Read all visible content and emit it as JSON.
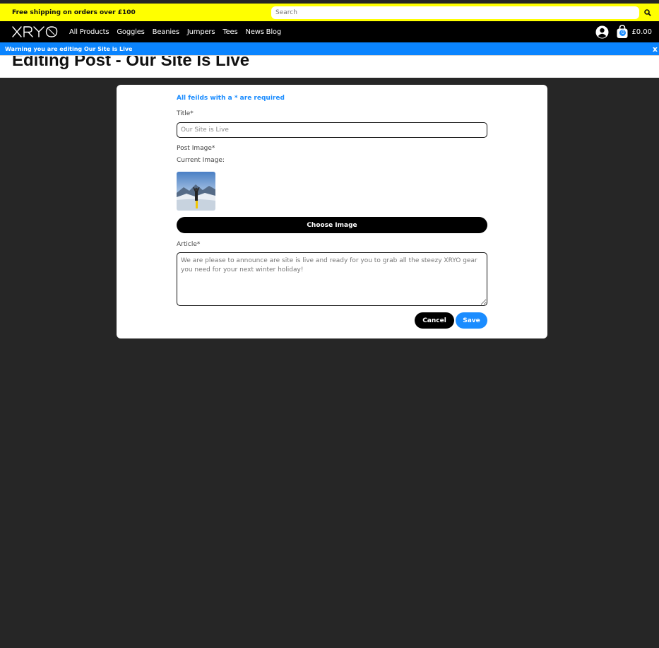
{
  "promo": {
    "text": "Free shipping on orders over £100"
  },
  "search": {
    "placeholder": "Search"
  },
  "nav": {
    "logo": "XRYO",
    "links": [
      "All Products",
      "Goggles",
      "Beanies",
      "Jumpers",
      "Tees",
      "News Blog"
    ],
    "cart_count": "0",
    "cart_total": "£0.00"
  },
  "warning": {
    "text": "Warning you are editing Our Site is Live",
    "close": "x"
  },
  "page": {
    "title": "Editing Post - Our Site Is Live"
  },
  "form": {
    "required_note": "All feilds with a * are required",
    "title_label": "Title*",
    "title_value": "Our Site is Live",
    "image_label": "Post Image*",
    "current_image_label": "Current Image:",
    "choose_image_label": "Choose Image",
    "article_label": "Article*",
    "article_value": "We are please to announce are site is live and ready for you to grab all the steezy XRYO gear you need for your next winter holiday!",
    "cancel_label": "Cancel",
    "save_label": "Save"
  },
  "colors": {
    "promo_bg": "#ffff00",
    "nav_bg": "#000000",
    "accent": "#1a8cff",
    "page_bg": "#262626"
  },
  "icons": {
    "search": "search-icon",
    "account": "account-icon",
    "bag": "shopping-bag-icon",
    "close": "close-icon"
  }
}
